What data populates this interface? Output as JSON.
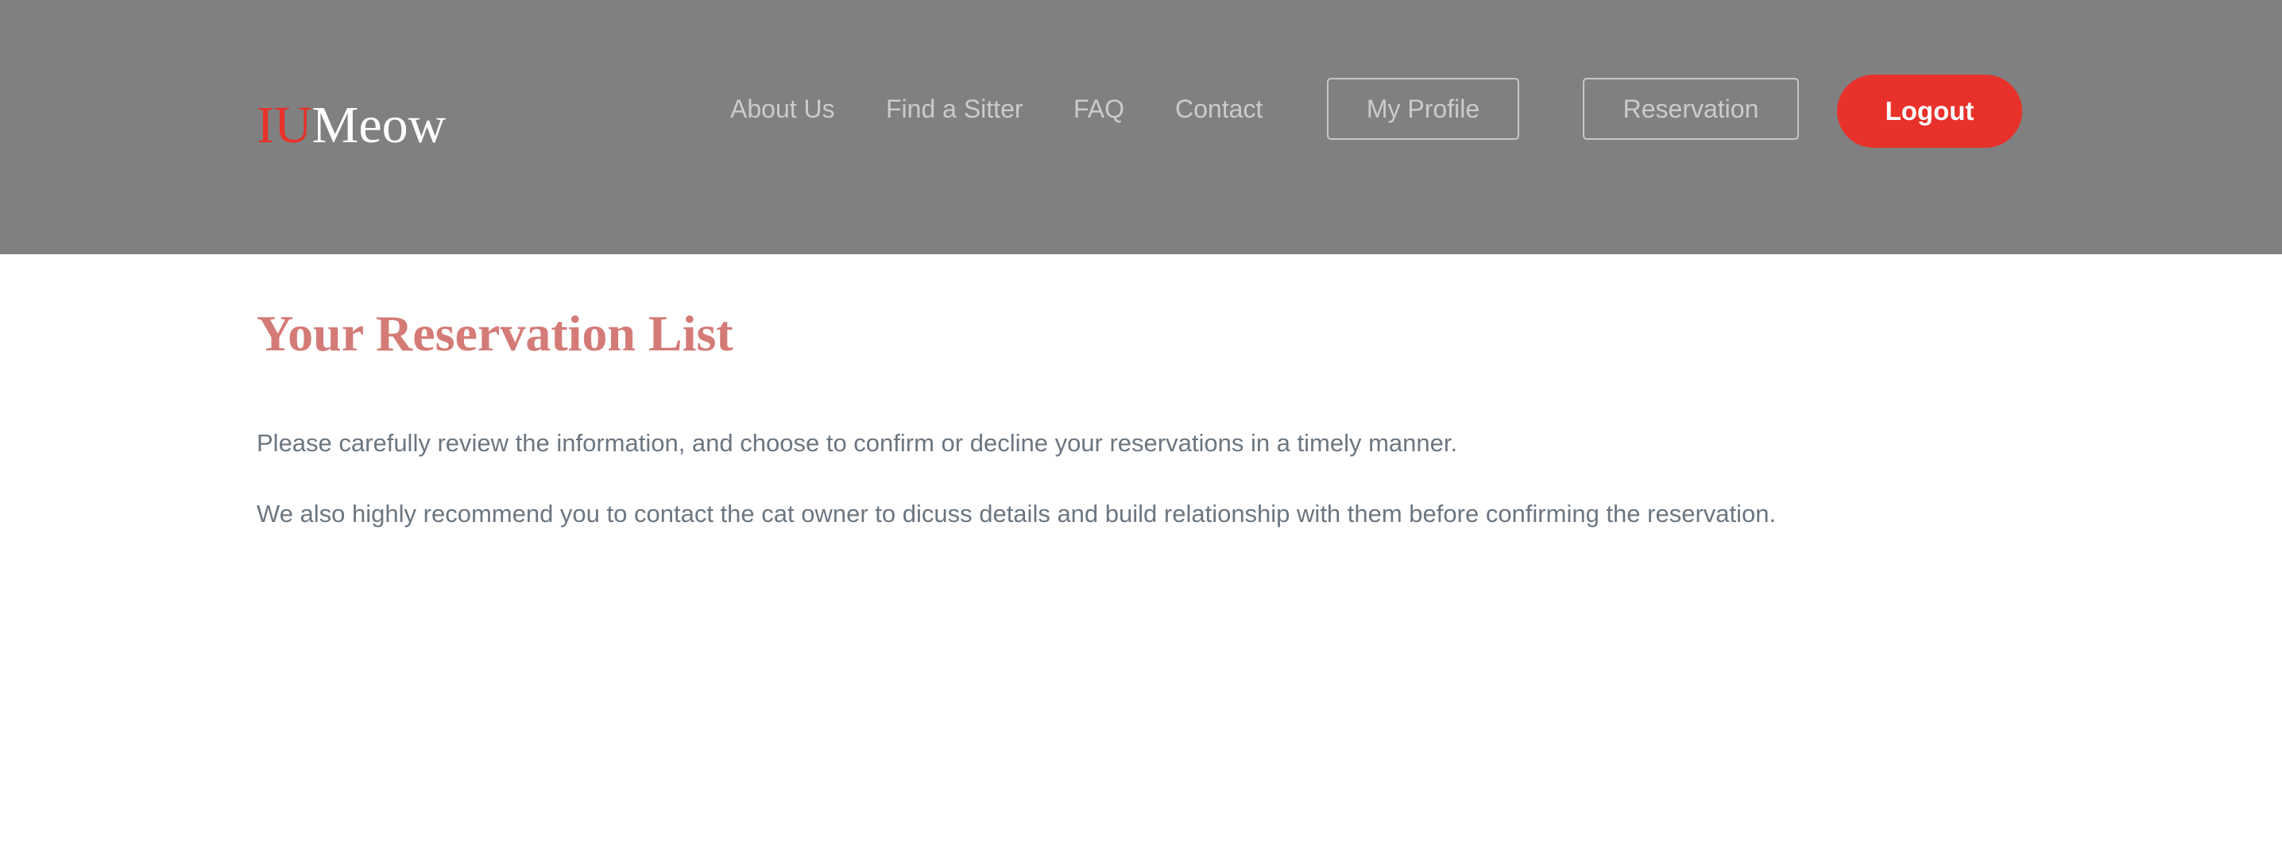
{
  "brand": {
    "logo_part1": "IU",
    "logo_part2": "Meow",
    "accent_color": "#e8312a",
    "header_bg": "#808080"
  },
  "nav": {
    "links": [
      "About Us",
      "Find a Sitter",
      "FAQ",
      "Contact"
    ],
    "my_profile": "My Profile",
    "reservation": "Reservation",
    "logout": "Logout"
  },
  "main": {
    "title": "Your Reservation List",
    "paragraphs": [
      "Please carefully review the information, and choose to confirm or decline your reservations in a timely manner.",
      "We also highly recommend you to contact the cat owner to dicuss details and build relationship with them before confirming the reservation."
    ]
  }
}
